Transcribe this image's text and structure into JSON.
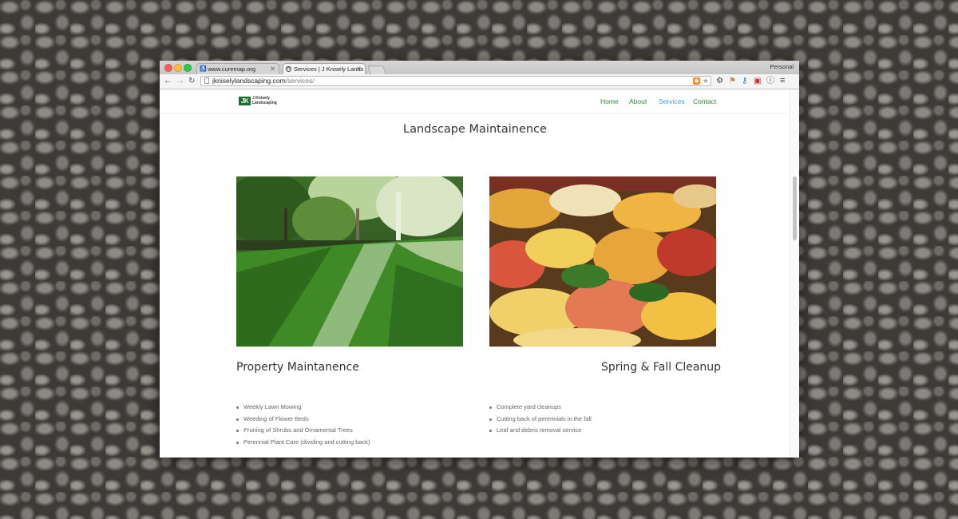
{
  "browser": {
    "tabs": [
      {
        "title": "www.curemap.org",
        "active": false
      },
      {
        "title": "Services | J Knisely Lands",
        "active": true
      }
    ],
    "profile_label": "Personal",
    "url_host": "jkniselylandscaping.com",
    "url_path": "/services/",
    "icons": {
      "back": "back-arrow-icon",
      "forward": "forward-arrow-icon",
      "reload": "reload-icon",
      "rss": "rss-icon",
      "star": "bookmark-star-icon",
      "menu": "hamburger-menu-icon"
    }
  },
  "site": {
    "logo_mark": "JK",
    "logo_name_line1": "J Knisely",
    "logo_name_line2": "Landscaping",
    "nav": [
      "Home",
      "About",
      "Services",
      "Contact"
    ],
    "nav_current": "Services",
    "link_color": "#2e8a3e",
    "current_link_color": "#2ea3f2"
  },
  "main": {
    "section_title": "Landscape Maintainence",
    "columns": [
      {
        "title": "Property Maintanence",
        "image": "striped green lawn with trees",
        "items": [
          "Weekly Lawn Mowing",
          "Weeding of Flower Beds",
          "Pruning of Shrubs and Ornamental Trees",
          "Perennial Plant Care (dividing and cutting back)"
        ]
      },
      {
        "title": "Spring & Fall Cleanup",
        "image": "colorful fallen autumn leaves",
        "items": [
          "Complete yard cleanups",
          "Cutting back of perennials in the fall",
          "Leaf and debris removal service"
        ]
      }
    ]
  }
}
